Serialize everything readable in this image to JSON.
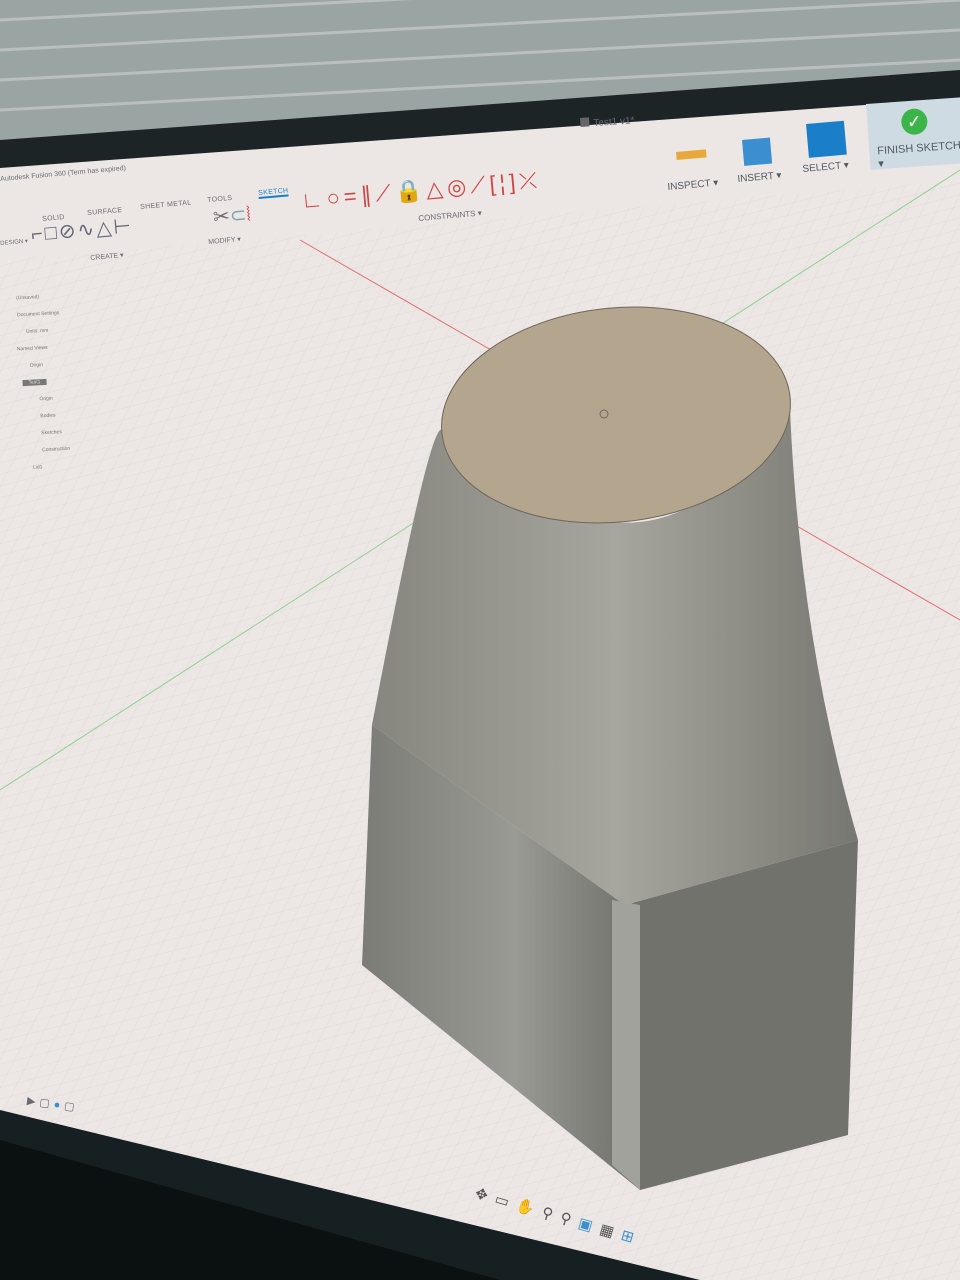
{
  "window": {
    "title": "Autodesk Fusion 360 (Term has expired)",
    "document_tab": "Test1 v1*"
  },
  "toolbar": {
    "tabs": [
      "SOLID",
      "SURFACE",
      "SHEET METAL",
      "TOOLS",
      "SKETCH"
    ],
    "active_tab": "SKETCH",
    "groups": {
      "create": "CREATE ▾",
      "modify": "MODIFY ▾",
      "constraints": "CONSTRAINTS ▾",
      "inspect": "INSPECT ▾",
      "insert": "INSERT ▾",
      "select": "SELECT ▾",
      "finish": "FINISH SKETCH ▾"
    },
    "design_menu": "DESIGN ▾"
  },
  "browser": {
    "items": [
      {
        "label": "(Unsaved)",
        "icon": "document-icon"
      },
      {
        "label": "Document Settings",
        "icon": "gear-icon"
      },
      {
        "label": "Units: mm",
        "icon": "units-icon"
      },
      {
        "label": "Named Views",
        "icon": "folder-icon"
      },
      {
        "label": "Origin",
        "icon": "folder-icon"
      },
      {
        "label": "Test1",
        "icon": "component-icon",
        "selected": true
      },
      {
        "label": "Origin",
        "icon": "folder-icon"
      },
      {
        "label": "Bodies",
        "icon": "folder-icon"
      },
      {
        "label": "Sketches",
        "icon": "folder-icon"
      },
      {
        "label": "Construction",
        "icon": "folder-icon"
      },
      {
        "label": "Lid1",
        "icon": "component-icon"
      }
    ]
  },
  "navbar": [
    "orbit",
    "look-at",
    "pan",
    "zoom-window",
    "zoom",
    "display-settings",
    "grid-settings",
    "viewports"
  ],
  "colors": {
    "accent": "#1a7fc8",
    "finish_bg": "#cfdbe3",
    "check": "#3bb54a",
    "constraint_red": "#d04343",
    "body": "#8e8e86",
    "sketch_face": "#b4a68e"
  }
}
